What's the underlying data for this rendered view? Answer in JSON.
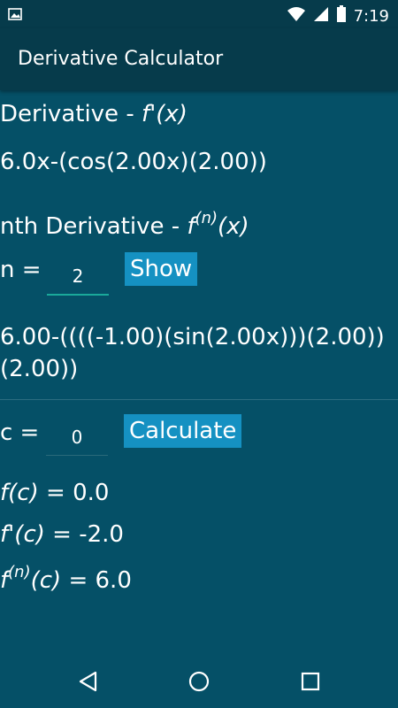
{
  "status_bar": {
    "time": "7:19",
    "icons": [
      "image-icon",
      "wifi-icon",
      "signal-icon",
      "battery-icon"
    ]
  },
  "app_bar": {
    "title": "Derivative Calculator"
  },
  "derivative": {
    "label_text": "Derivative - ",
    "label_math": "f'(x)",
    "result": "6.0x-(cos(2.00x)(2.00))"
  },
  "nth_derivative": {
    "label_text": "nth Derivative - ",
    "label_f": "f",
    "label_sup": "(n)",
    "label_x": "(x)",
    "n_label": "n =",
    "n_value": "2",
    "show_button": "Show",
    "result_line1": "6.00-((((-1.00)(sin(2.00x)))(2.00))",
    "result_line2": "(2.00))"
  },
  "evaluate": {
    "c_label": "c =",
    "c_value": "0",
    "calculate_button": "Calculate",
    "fc_label": "f(c)",
    "fc_value": " = 0.0",
    "fpc_label": "f'(c)",
    "fpc_value": " = -2.0",
    "fnc_f": "f",
    "fnc_sup": "(n)",
    "fnc_c": "(c)",
    "fnc_value": " = 6.0"
  },
  "nav_bar": {
    "icons": [
      "back-icon",
      "home-icon",
      "recents-icon"
    ]
  },
  "colors": {
    "background": "#055067",
    "app_bar": "#063b4b",
    "button": "#1591c2",
    "input_underline": "#1aa99a"
  }
}
